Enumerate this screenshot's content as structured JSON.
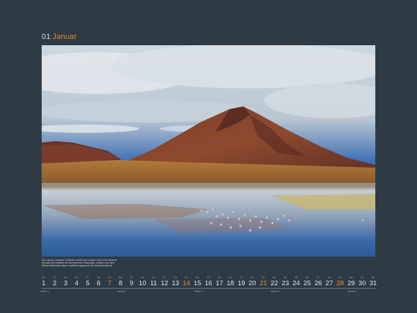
{
  "header": {
    "number": "01",
    "month": "Januar"
  },
  "photo": {
    "caption": "Die Laguna Colorada in Bolivien erhält ihren Namen nicht ohne weiteres wie das rote Gefieder der dort lebenden Flamingos, sondern von dem Wasser färbenden Algen und Mikroorganismen im Mineralsediment."
  },
  "calendar": {
    "days": [
      {
        "wd": "Mo",
        "d": "1",
        "sun": false
      },
      {
        "wd": "Di",
        "d": "2",
        "sun": false
      },
      {
        "wd": "Mi",
        "d": "3",
        "sun": false
      },
      {
        "wd": "Do",
        "d": "4",
        "sun": false
      },
      {
        "wd": "Fr",
        "d": "5",
        "sun": false
      },
      {
        "wd": "Sa",
        "d": "6",
        "sun": false
      },
      {
        "wd": "So",
        "d": "7",
        "sun": true
      },
      {
        "wd": "Mo",
        "d": "8",
        "sun": false
      },
      {
        "wd": "Di",
        "d": "9",
        "sun": false
      },
      {
        "wd": "Mi",
        "d": "10",
        "sun": false
      },
      {
        "wd": "Do",
        "d": "11",
        "sun": false
      },
      {
        "wd": "Fr",
        "d": "12",
        "sun": false
      },
      {
        "wd": "Sa",
        "d": "13",
        "sun": false
      },
      {
        "wd": "So",
        "d": "14",
        "sun": true
      },
      {
        "wd": "Mo",
        "d": "15",
        "sun": false
      },
      {
        "wd": "Di",
        "d": "16",
        "sun": false
      },
      {
        "wd": "Mi",
        "d": "17",
        "sun": false
      },
      {
        "wd": "Do",
        "d": "18",
        "sun": false
      },
      {
        "wd": "Fr",
        "d": "19",
        "sun": false
      },
      {
        "wd": "Sa",
        "d": "20",
        "sun": false
      },
      {
        "wd": "So",
        "d": "21",
        "sun": true
      },
      {
        "wd": "Mo",
        "d": "22",
        "sun": false
      },
      {
        "wd": "Di",
        "d": "23",
        "sun": false
      },
      {
        "wd": "Mi",
        "d": "24",
        "sun": false
      },
      {
        "wd": "Do",
        "d": "25",
        "sun": false
      },
      {
        "wd": "Fr",
        "d": "26",
        "sun": false
      },
      {
        "wd": "Sa",
        "d": "27",
        "sun": false
      },
      {
        "wd": "So",
        "d": "28",
        "sun": true
      },
      {
        "wd": "Mo",
        "d": "29",
        "sun": false
      },
      {
        "wd": "Di",
        "d": "30",
        "sun": false
      },
      {
        "wd": "Mi",
        "d": "31",
        "sun": false
      }
    ],
    "weeks": [
      {
        "label": "Woche 1",
        "start_index": 0
      },
      {
        "label": "Woche 2",
        "start_index": 7
      },
      {
        "label": "Woche 3",
        "start_index": 14
      },
      {
        "label": "Woche 4",
        "start_index": 21
      },
      {
        "label": "Woche 5",
        "start_index": 28
      }
    ]
  },
  "colors": {
    "background": "#2f3b44",
    "accent": "#e8892f"
  }
}
